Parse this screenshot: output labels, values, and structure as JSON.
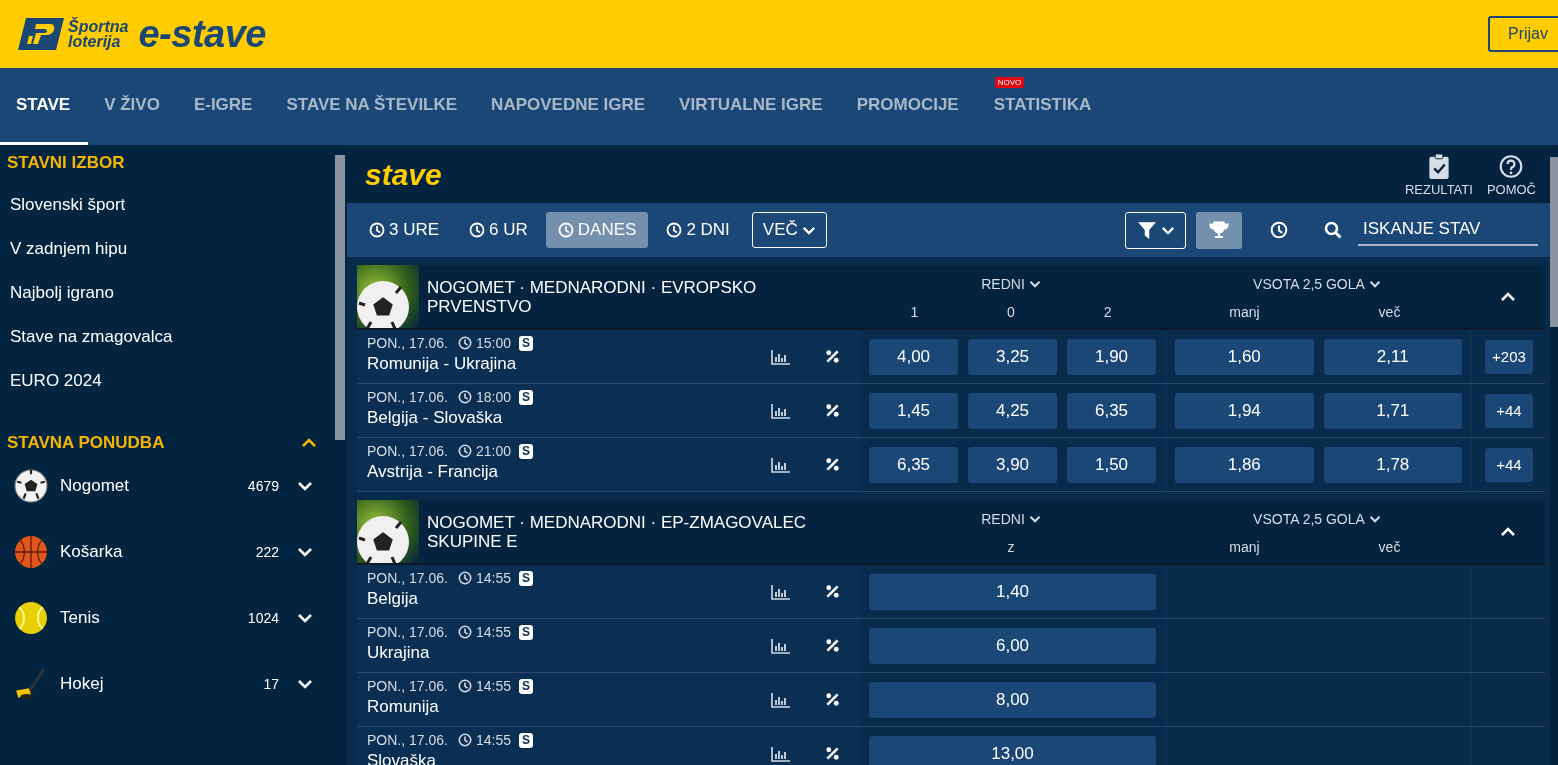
{
  "header": {
    "brand_line1": "Športna",
    "brand_line2": "loterija",
    "product": "e-stave",
    "login_button": "Prijav"
  },
  "nav": [
    {
      "label": "STAVE",
      "selected": true
    },
    {
      "label": "V ŽIVO",
      "selected": false
    },
    {
      "label": "E-IGRE",
      "selected": false
    },
    {
      "label": "STAVE NA ŠTEVILKE",
      "selected": false
    },
    {
      "label": "NAPOVEDNE IGRE",
      "selected": false
    },
    {
      "label": "VIRTUALNE IGRE",
      "selected": false
    },
    {
      "label": "PROMOCIJE",
      "selected": false
    },
    {
      "label": "STATISTIKA",
      "selected": false,
      "badge": "NOVO"
    }
  ],
  "sidebar": {
    "quick_title": "STAVNI IZBOR",
    "quick_items": [
      "Slovenski šport",
      "V zadnjem hipu",
      "Najbolj igrano",
      "Stave na zmagovalca",
      "EURO 2024"
    ],
    "offer_title": "STAVNA PONUDBA",
    "offer_expanded": true,
    "sports": [
      {
        "name": "Nogomet",
        "count": "4679",
        "kind": "football",
        "expanded": false
      },
      {
        "name": "Košarka",
        "count": "222",
        "kind": "basketball",
        "expanded": false
      },
      {
        "name": "Tenis",
        "count": "1024",
        "kind": "tennis",
        "expanded": false
      },
      {
        "name": "Hokej",
        "count": "17",
        "kind": "hockey",
        "expanded": false
      }
    ]
  },
  "page": {
    "title": "stave",
    "actions": [
      {
        "label": "REZULTATI",
        "kind": "results"
      },
      {
        "label": "POMOČ",
        "kind": "help"
      }
    ]
  },
  "filters": {
    "time_ranges": [
      {
        "label": "3 URE",
        "selected": false
      },
      {
        "label": "6 UR",
        "selected": false
      },
      {
        "label": "DANES",
        "selected": true
      },
      {
        "label": "2 DNI",
        "selected": false
      }
    ],
    "more": "VEČ",
    "trophy_filter": {
      "selected": true
    },
    "search": {
      "placeholder": "ISKANJE STAV"
    }
  },
  "sections": [
    {
      "title": "NOGOMET · MEDNARODNI · EVROPSKO PRVENSTVO",
      "expanded": true,
      "markets": [
        {
          "title": "REDNI",
          "columns": [
            "1",
            "0",
            "2"
          ]
        },
        {
          "title": "VSOTA 2,5 GOLA",
          "columns": [
            "manj",
            "več"
          ]
        }
      ],
      "events": [
        {
          "date": "PON., 17.06.",
          "time": "15:00",
          "badge": "S",
          "name": "Romunija - Ukrajina",
          "odds": [
            "4,00",
            "3,25",
            "1,90",
            "1,60",
            "2,11"
          ],
          "more": "+203"
        },
        {
          "date": "PON., 17.06.",
          "time": "18:00",
          "badge": "S",
          "name": "Belgija - Slovaška",
          "odds": [
            "1,45",
            "4,25",
            "6,35",
            "1,94",
            "1,71"
          ],
          "more": "+44"
        },
        {
          "date": "PON., 17.06.",
          "time": "21:00",
          "badge": "S",
          "name": "Avstrija - Francija",
          "odds": [
            "6,35",
            "3,90",
            "1,50",
            "1,86",
            "1,78"
          ],
          "more": "+44"
        }
      ]
    },
    {
      "title": "NOGOMET · MEDNARODNI · EP-ZMAGOVALEC SKUPINE E",
      "expanded": true,
      "markets": [
        {
          "title": "REDNI",
          "columns": [
            "z"
          ]
        },
        {
          "title": "VSOTA 2,5 GOLA",
          "columns": [
            "manj",
            "več"
          ]
        }
      ],
      "events": [
        {
          "date": "PON., 17.06.",
          "time": "14:55",
          "badge": "S",
          "name": "Belgija",
          "odds": [
            "1,40"
          ]
        },
        {
          "date": "PON., 17.06.",
          "time": "14:55",
          "badge": "S",
          "name": "Ukrajina",
          "odds": [
            "6,00"
          ]
        },
        {
          "date": "PON., 17.06.",
          "time": "14:55",
          "badge": "S",
          "name": "Romunija",
          "odds": [
            "8,00"
          ]
        },
        {
          "date": "PON., 17.06.",
          "time": "14:55",
          "badge": "S",
          "name": "Slovaška",
          "odds": [
            "13,00"
          ]
        }
      ]
    }
  ]
}
